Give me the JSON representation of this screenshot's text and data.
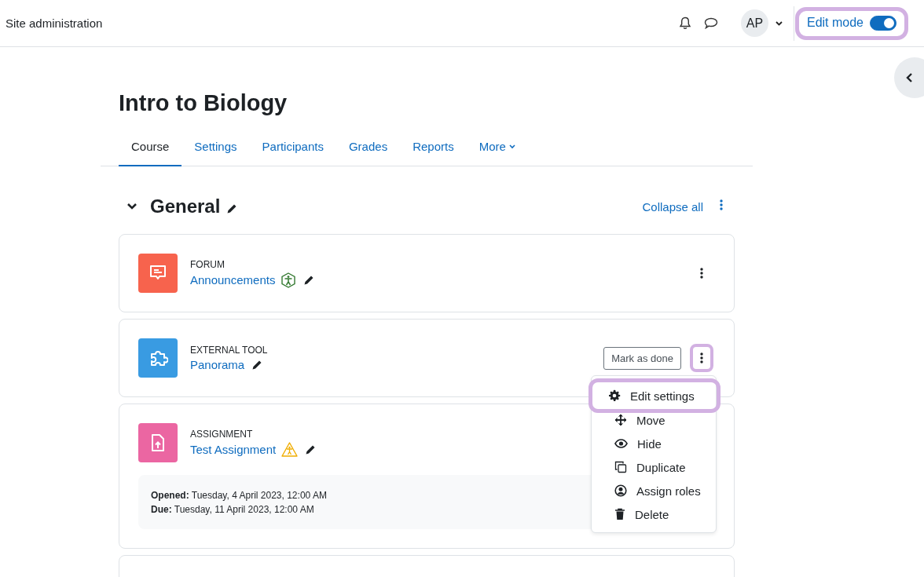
{
  "header": {
    "site_link": "Site administration",
    "avatar_initials": "AP",
    "edit_mode": {
      "label": "Edit mode",
      "on": true,
      "highlighted": true
    }
  },
  "course": {
    "title": "Intro to Biology"
  },
  "tabs": [
    {
      "label": "Course",
      "selected": true,
      "dropdown": false
    },
    {
      "label": "Settings",
      "selected": false,
      "dropdown": false
    },
    {
      "label": "Participants",
      "selected": false,
      "dropdown": false
    },
    {
      "label": "Grades",
      "selected": false,
      "dropdown": false
    },
    {
      "label": "Reports",
      "selected": false,
      "dropdown": false
    },
    {
      "label": "More",
      "selected": false,
      "dropdown": true
    }
  ],
  "section": {
    "title": "General",
    "expanded": true,
    "collapse_all": "Collapse all"
  },
  "activities": [
    {
      "kind": "forum",
      "type_label": "FORUM",
      "name": "Announcements",
      "accessibility": {
        "kind": "good"
      },
      "menu_highlighted": false
    },
    {
      "kind": "external",
      "type_label": "EXTERNAL TOOL",
      "name": "Panorama",
      "mark_done": "Mark as done",
      "menu_highlighted": true
    },
    {
      "kind": "assignment",
      "type_label": "ASSIGNMENT",
      "name": "Test Assignment",
      "accessibility": {
        "kind": "warning"
      },
      "dates": [
        {
          "label": "Opened:",
          "value": "Tuesday, 4 April 2023, 12:00 AM"
        },
        {
          "label": "Due:",
          "value": "Tuesday, 11 April 2023, 12:00 AM"
        }
      ]
    }
  ],
  "action_menu": [
    {
      "kind": "settings",
      "label": "Edit settings",
      "highlighted": true
    },
    {
      "kind": "move",
      "label": "Move",
      "highlighted": false
    },
    {
      "kind": "hide",
      "label": "Hide",
      "highlighted": false
    },
    {
      "kind": "duplicate",
      "label": "Duplicate",
      "highlighted": false
    },
    {
      "kind": "roles",
      "label": "Assign roles",
      "highlighted": false
    },
    {
      "kind": "delete",
      "label": "Delete",
      "highlighted": false
    }
  ]
}
